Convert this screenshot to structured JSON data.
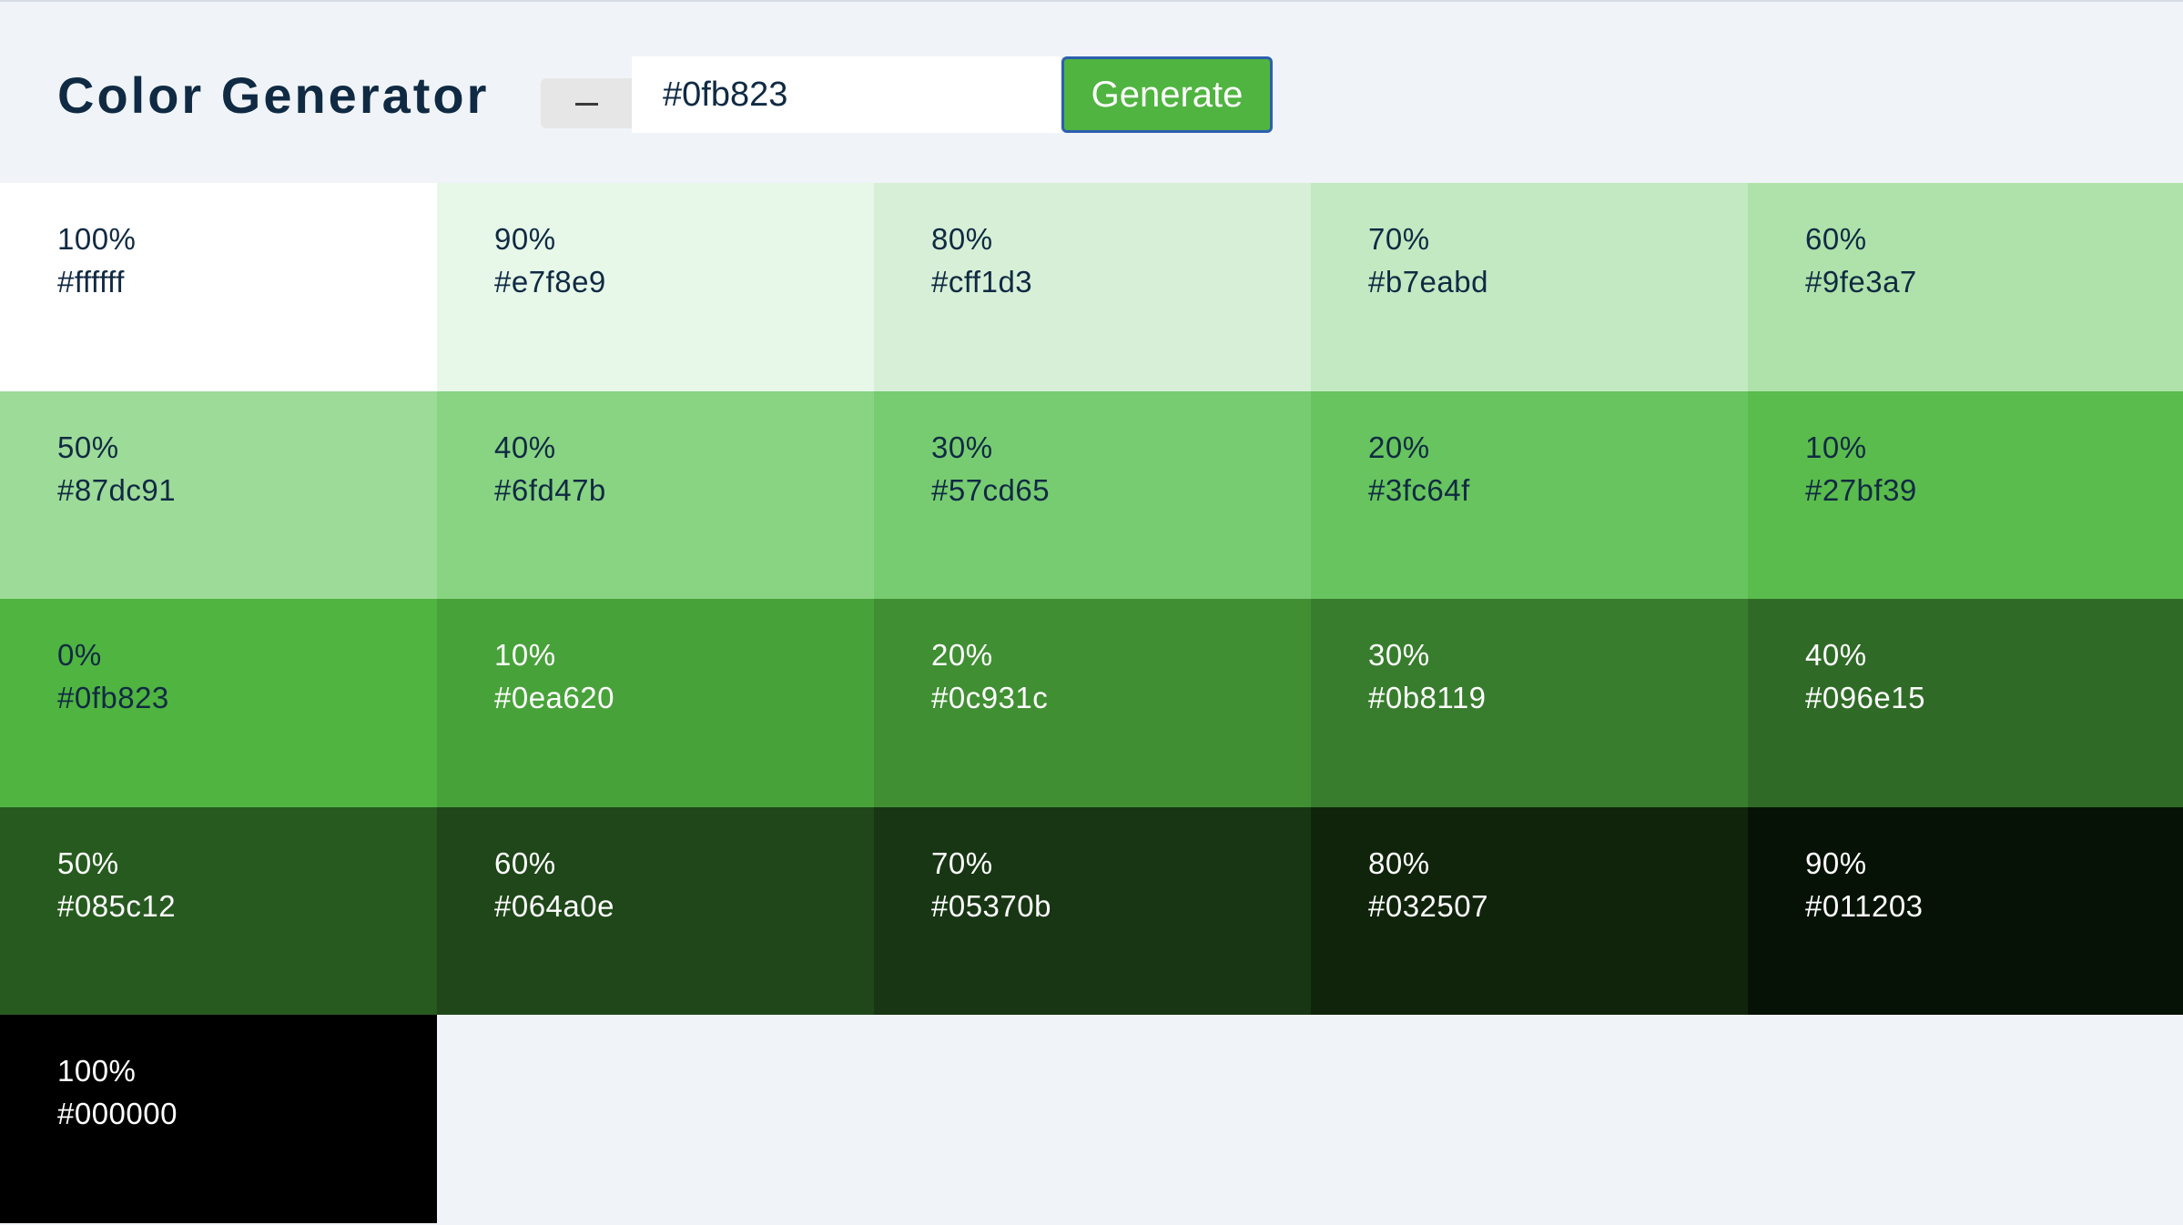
{
  "header": {
    "title": "Color Generator",
    "input_value": "#0fb823",
    "generate_label": "Generate"
  },
  "palette": [
    {
      "percent": "100%",
      "hex": "#ffffff",
      "color": "#ffffff",
      "dark": false
    },
    {
      "percent": "90%",
      "hex": "#e7f8e9",
      "color": "#e7f8e9",
      "dark": false
    },
    {
      "percent": "80%",
      "hex": "#cff1d3",
      "color": "#d6efd6",
      "dark": false
    },
    {
      "percent": "70%",
      "hex": "#b7eabd",
      "color": "#c2e9c2",
      "dark": false
    },
    {
      "percent": "60%",
      "hex": "#9fe3a7",
      "color": "#aee2aa",
      "dark": false
    },
    {
      "percent": "50%",
      "hex": "#87dc91",
      "color": "#9ddb98",
      "dark": false
    },
    {
      "percent": "40%",
      "hex": "#6fd47b",
      "color": "#88d483",
      "dark": false
    },
    {
      "percent": "30%",
      "hex": "#57cd65",
      "color": "#77cc71",
      "dark": false
    },
    {
      "percent": "20%",
      "hex": "#3fc64f",
      "color": "#67c45e",
      "dark": false
    },
    {
      "percent": "10%",
      "hex": "#27bf39",
      "color": "#5abc4c",
      "dark": false
    },
    {
      "percent": "0%",
      "hex": "#0fb823",
      "color": "#50b440",
      "dark": false
    },
    {
      "percent": "10%",
      "hex": "#0ea620",
      "color": "#48a23a",
      "dark": true
    },
    {
      "percent": "20%",
      "hex": "#0c931c",
      "color": "#408f33",
      "dark": true
    },
    {
      "percent": "30%",
      "hex": "#0b8119",
      "color": "#387d2d",
      "dark": true
    },
    {
      "percent": "40%",
      "hex": "#096e15",
      "color": "#2f6b26",
      "dark": true
    },
    {
      "percent": "50%",
      "hex": "#085c12",
      "color": "#275a1f",
      "dark": true
    },
    {
      "percent": "60%",
      "hex": "#064a0e",
      "color": "#1f4719",
      "dark": true
    },
    {
      "percent": "70%",
      "hex": "#05370b",
      "color": "#183613",
      "dark": true
    },
    {
      "percent": "80%",
      "hex": "#032507",
      "color": "#10240c",
      "dark": true
    },
    {
      "percent": "90%",
      "hex": "#011203",
      "color": "#071206",
      "dark": true
    },
    {
      "percent": "100%",
      "hex": "#000000",
      "color": "#000000",
      "dark": true
    }
  ]
}
